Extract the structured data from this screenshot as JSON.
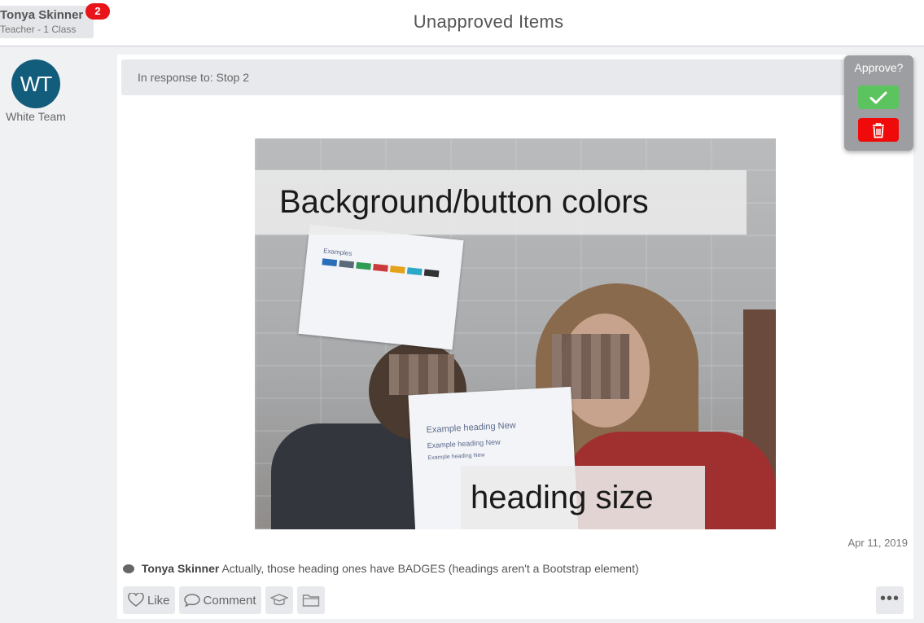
{
  "header": {
    "user_name": "Tonya Skinner",
    "user_role": "Teacher - 1 Class",
    "notification_count": "2",
    "page_title": "Unapproved Items"
  },
  "sidebar": {
    "avatar_initials": "WT",
    "avatar_label": "White Team",
    "avatar_color": "#125c7c"
  },
  "post": {
    "in_response_to": "In response to: Stop 2",
    "image_caption_top": "Background/button colors",
    "image_caption_bottom": "heading size",
    "paper_top_heading": "Examples",
    "paper_bottom_lines": [
      "Example heading New",
      "Example heading New",
      "Example heading New"
    ],
    "date": "Apr 11, 2019",
    "comment": {
      "author": "Tonya Skinner",
      "text": "Actually, those heading ones have BADGES (headings aren't a Bootstrap element)"
    },
    "actions": {
      "like_label": "Like",
      "comment_label": "Comment",
      "portfolio_icon": "graduation-cap-icon",
      "folder_icon": "folder-icon",
      "more_icon": "ellipsis-icon"
    }
  },
  "approve_panel": {
    "title": "Approve?",
    "approve_icon": "checkmark-icon",
    "delete_icon": "trash-icon",
    "approve_color": "#5cc45e",
    "delete_color": "#f10a0a"
  },
  "colors": {
    "badge_red": "#e8141a"
  }
}
